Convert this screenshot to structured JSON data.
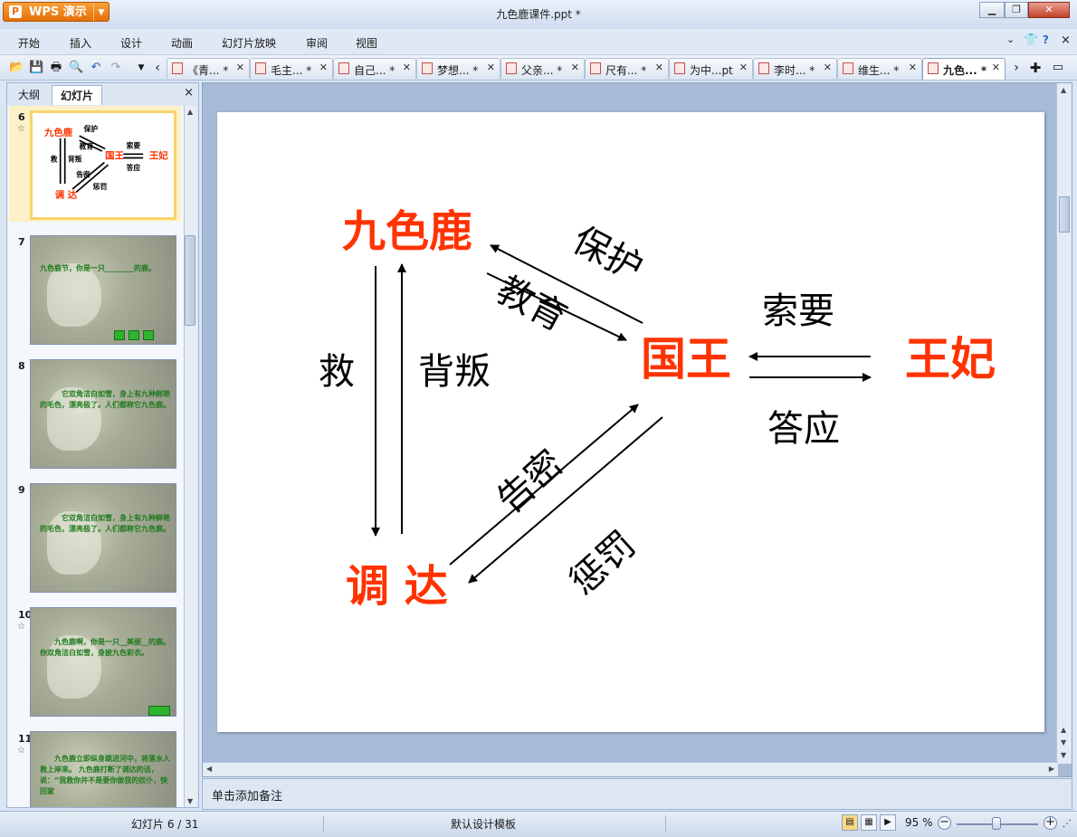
{
  "app": {
    "wps_button": "WPS 演示",
    "window_title": "九色鹿课件.ppt *"
  },
  "menu": [
    "开始",
    "插入",
    "设计",
    "动画",
    "幻灯片放映",
    "审阅",
    "视图"
  ],
  "tabs": [
    {
      "label": "《青...",
      "mark": "*"
    },
    {
      "label": "毛主...",
      "mark": "*"
    },
    {
      "label": "自己...",
      "mark": "*"
    },
    {
      "label": "梦想...",
      "mark": "*"
    },
    {
      "label": "父亲...",
      "mark": "*"
    },
    {
      "label": "尺有...",
      "mark": "*"
    },
    {
      "label": "为中...pt",
      "mark": ""
    },
    {
      "label": "李时...",
      "mark": "*"
    },
    {
      "label": "维生...",
      "mark": "*"
    },
    {
      "label": "九色...",
      "mark": "*"
    }
  ],
  "left_pane": {
    "tab_outline": "大纲",
    "tab_slides": "幻灯片",
    "close": "×"
  },
  "thumbnails": [
    {
      "num": "6",
      "star": "☆"
    },
    {
      "num": "7",
      "star": "",
      "text": "九色鹿节，你是一只________的鹿。"
    },
    {
      "num": "8",
      "star": "",
      "text": "它双角洁白如雪，身上有九种鲜艳的毛色，漂亮极了。人们都称它九色鹿。"
    },
    {
      "num": "9",
      "star": "",
      "text": "它双角洁白如雪，身上有九种鲜艳的毛色，漂亮极了。人们都称它九色鹿。"
    },
    {
      "num": "10",
      "star": "☆",
      "text": "九色鹿啊，你是一只__美丽__的鹿。你双角洁白如雪，身披九色彩衣。"
    },
    {
      "num": "11",
      "star": "☆",
      "text": "九色鹿立即纵身跳进河中，将落水人救上岸来。 九色鹿打断了调达的话，说：“我救你并不是要你做我的奴仆，快回家"
    }
  ],
  "thumb6": {
    "jiuselu": "九色鹿",
    "baohu": "保护",
    "jiaoyu": "教育",
    "jiu": "救",
    "beipan": "背叛",
    "guowang": "国王",
    "suoyao": "索要",
    "daying": "答应",
    "wangfei": "王妃",
    "gaomi": "告密",
    "chengfa": "惩罚",
    "tiaoda": "调 达"
  },
  "slide": {
    "jiuselu": "九色鹿",
    "guowang": "国王",
    "wangfei": "王妃",
    "tiaoda": "调 达",
    "baohu": "保护",
    "jiaoyu": "教育",
    "jiu": "救",
    "beipan": "背叛",
    "suoyao": "索要",
    "daying": "答应",
    "gaomi": "告密",
    "chengfa": "惩罚",
    "colors": {
      "accent": "#ff3300",
      "text": "#000000"
    }
  },
  "notes": "单击添加备注",
  "status": {
    "slide_counter": "幻灯片 6 / 31",
    "template": "默认设计模板",
    "zoom": "95 %"
  }
}
